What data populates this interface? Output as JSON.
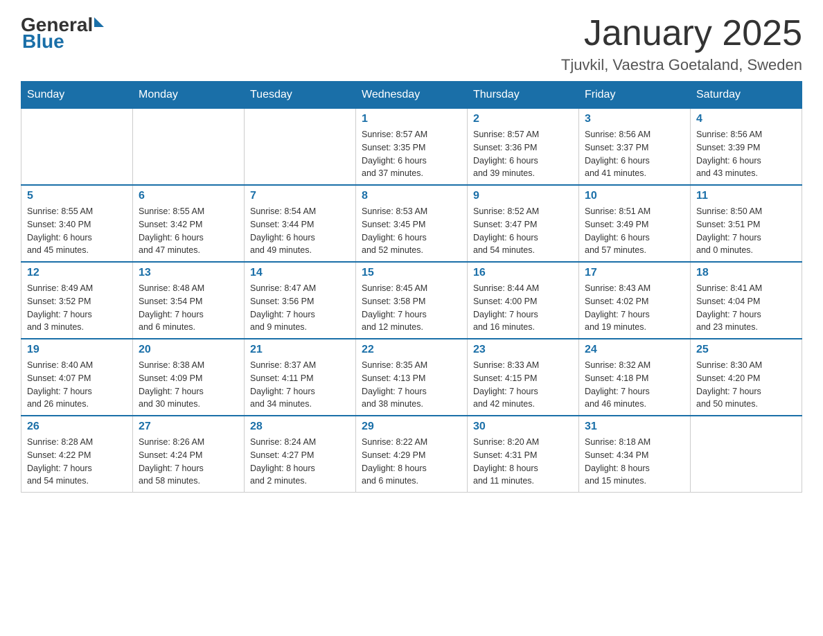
{
  "logo": {
    "general": "General",
    "blue": "Blue"
  },
  "title": "January 2025",
  "subtitle": "Tjuvkil, Vaestra Goetaland, Sweden",
  "weekdays": [
    "Sunday",
    "Monday",
    "Tuesday",
    "Wednesday",
    "Thursday",
    "Friday",
    "Saturday"
  ],
  "weeks": [
    [
      {
        "day": "",
        "info": ""
      },
      {
        "day": "",
        "info": ""
      },
      {
        "day": "",
        "info": ""
      },
      {
        "day": "1",
        "info": "Sunrise: 8:57 AM\nSunset: 3:35 PM\nDaylight: 6 hours\nand 37 minutes."
      },
      {
        "day": "2",
        "info": "Sunrise: 8:57 AM\nSunset: 3:36 PM\nDaylight: 6 hours\nand 39 minutes."
      },
      {
        "day": "3",
        "info": "Sunrise: 8:56 AM\nSunset: 3:37 PM\nDaylight: 6 hours\nand 41 minutes."
      },
      {
        "day": "4",
        "info": "Sunrise: 8:56 AM\nSunset: 3:39 PM\nDaylight: 6 hours\nand 43 minutes."
      }
    ],
    [
      {
        "day": "5",
        "info": "Sunrise: 8:55 AM\nSunset: 3:40 PM\nDaylight: 6 hours\nand 45 minutes."
      },
      {
        "day": "6",
        "info": "Sunrise: 8:55 AM\nSunset: 3:42 PM\nDaylight: 6 hours\nand 47 minutes."
      },
      {
        "day": "7",
        "info": "Sunrise: 8:54 AM\nSunset: 3:44 PM\nDaylight: 6 hours\nand 49 minutes."
      },
      {
        "day": "8",
        "info": "Sunrise: 8:53 AM\nSunset: 3:45 PM\nDaylight: 6 hours\nand 52 minutes."
      },
      {
        "day": "9",
        "info": "Sunrise: 8:52 AM\nSunset: 3:47 PM\nDaylight: 6 hours\nand 54 minutes."
      },
      {
        "day": "10",
        "info": "Sunrise: 8:51 AM\nSunset: 3:49 PM\nDaylight: 6 hours\nand 57 minutes."
      },
      {
        "day": "11",
        "info": "Sunrise: 8:50 AM\nSunset: 3:51 PM\nDaylight: 7 hours\nand 0 minutes."
      }
    ],
    [
      {
        "day": "12",
        "info": "Sunrise: 8:49 AM\nSunset: 3:52 PM\nDaylight: 7 hours\nand 3 minutes."
      },
      {
        "day": "13",
        "info": "Sunrise: 8:48 AM\nSunset: 3:54 PM\nDaylight: 7 hours\nand 6 minutes."
      },
      {
        "day": "14",
        "info": "Sunrise: 8:47 AM\nSunset: 3:56 PM\nDaylight: 7 hours\nand 9 minutes."
      },
      {
        "day": "15",
        "info": "Sunrise: 8:45 AM\nSunset: 3:58 PM\nDaylight: 7 hours\nand 12 minutes."
      },
      {
        "day": "16",
        "info": "Sunrise: 8:44 AM\nSunset: 4:00 PM\nDaylight: 7 hours\nand 16 minutes."
      },
      {
        "day": "17",
        "info": "Sunrise: 8:43 AM\nSunset: 4:02 PM\nDaylight: 7 hours\nand 19 minutes."
      },
      {
        "day": "18",
        "info": "Sunrise: 8:41 AM\nSunset: 4:04 PM\nDaylight: 7 hours\nand 23 minutes."
      }
    ],
    [
      {
        "day": "19",
        "info": "Sunrise: 8:40 AM\nSunset: 4:07 PM\nDaylight: 7 hours\nand 26 minutes."
      },
      {
        "day": "20",
        "info": "Sunrise: 8:38 AM\nSunset: 4:09 PM\nDaylight: 7 hours\nand 30 minutes."
      },
      {
        "day": "21",
        "info": "Sunrise: 8:37 AM\nSunset: 4:11 PM\nDaylight: 7 hours\nand 34 minutes."
      },
      {
        "day": "22",
        "info": "Sunrise: 8:35 AM\nSunset: 4:13 PM\nDaylight: 7 hours\nand 38 minutes."
      },
      {
        "day": "23",
        "info": "Sunrise: 8:33 AM\nSunset: 4:15 PM\nDaylight: 7 hours\nand 42 minutes."
      },
      {
        "day": "24",
        "info": "Sunrise: 8:32 AM\nSunset: 4:18 PM\nDaylight: 7 hours\nand 46 minutes."
      },
      {
        "day": "25",
        "info": "Sunrise: 8:30 AM\nSunset: 4:20 PM\nDaylight: 7 hours\nand 50 minutes."
      }
    ],
    [
      {
        "day": "26",
        "info": "Sunrise: 8:28 AM\nSunset: 4:22 PM\nDaylight: 7 hours\nand 54 minutes."
      },
      {
        "day": "27",
        "info": "Sunrise: 8:26 AM\nSunset: 4:24 PM\nDaylight: 7 hours\nand 58 minutes."
      },
      {
        "day": "28",
        "info": "Sunrise: 8:24 AM\nSunset: 4:27 PM\nDaylight: 8 hours\nand 2 minutes."
      },
      {
        "day": "29",
        "info": "Sunrise: 8:22 AM\nSunset: 4:29 PM\nDaylight: 8 hours\nand 6 minutes."
      },
      {
        "day": "30",
        "info": "Sunrise: 8:20 AM\nSunset: 4:31 PM\nDaylight: 8 hours\nand 11 minutes."
      },
      {
        "day": "31",
        "info": "Sunrise: 8:18 AM\nSunset: 4:34 PM\nDaylight: 8 hours\nand 15 minutes."
      },
      {
        "day": "",
        "info": ""
      }
    ]
  ]
}
